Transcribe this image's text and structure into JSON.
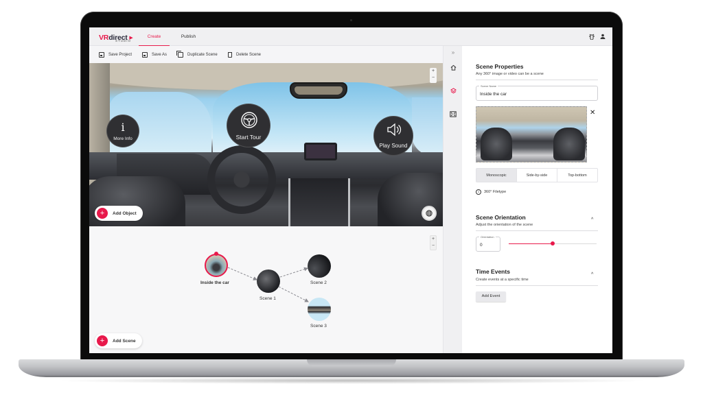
{
  "app": {
    "logo_main_vr": "VR",
    "logo_main_rest": "direct",
    "logo_sub": "STUDIO",
    "brand_color": "#e8194b"
  },
  "nav": {
    "tabs": [
      {
        "label": "Create",
        "active": true
      },
      {
        "label": "Publish",
        "active": false
      }
    ],
    "icons": [
      "bug-icon",
      "user-icon"
    ]
  },
  "toolbar": {
    "items": [
      {
        "label": "Save Project",
        "icon": "save-icon"
      },
      {
        "label": "Save As",
        "icon": "save-as-icon"
      },
      {
        "label": "Duplicate Scene",
        "icon": "duplicate-icon"
      },
      {
        "label": "Delete Scene",
        "icon": "trash-icon"
      }
    ]
  },
  "viewer": {
    "hotspots": [
      {
        "label": "More Info",
        "glyph": "i",
        "icon": "info-icon"
      },
      {
        "label": "Start Tour",
        "icon": "steering-wheel-icon"
      },
      {
        "label": "Play Sound",
        "icon": "speaker-icon"
      }
    ],
    "add_object_label": "Add Object",
    "zoom_in": "+",
    "zoom_out": "−"
  },
  "graph": {
    "nodes": [
      {
        "label": "Inside the car",
        "selected": true
      },
      {
        "label": "Scene 1"
      },
      {
        "label": "Scene 2"
      },
      {
        "label": "Scene 3"
      }
    ],
    "edges": [
      [
        "Inside the car",
        "Scene 1"
      ],
      [
        "Scene 1",
        "Scene 2"
      ],
      [
        "Scene 1",
        "Scene 3"
      ]
    ],
    "add_scene_label": "Add Scene",
    "zoom_in": "+",
    "zoom_out": "−"
  },
  "iconstrip": {
    "expand": "»",
    "items": [
      "home-icon",
      "layers-icon",
      "panorama-icon"
    ],
    "active_index": 1
  },
  "properties": {
    "scene_title": "Scene Properties",
    "scene_subtitle": "Any 360° image or video can be a scene",
    "scene_name_label": "Scene Name",
    "scene_name_value": "Inside the car",
    "close_glyph": "✕",
    "stereo_options": [
      {
        "label": "Monoscopic",
        "active": true
      },
      {
        "label": "Side-by-side",
        "active": false
      },
      {
        "label": "Top-bottom",
        "active": false
      }
    ],
    "filetype_label": "360° Filetype",
    "orientation_title": "Scene Orientation",
    "orientation_subtitle": "Adjust the orientation of the scene",
    "orientation_field_label": "Orientation",
    "orientation_value": "0",
    "orientation_slider_fraction": 0.5,
    "time_events_title": "Time Events",
    "time_events_subtitle": "Create events at a specific time",
    "add_event_label": "Add Event",
    "collapse_glyph": "^"
  }
}
